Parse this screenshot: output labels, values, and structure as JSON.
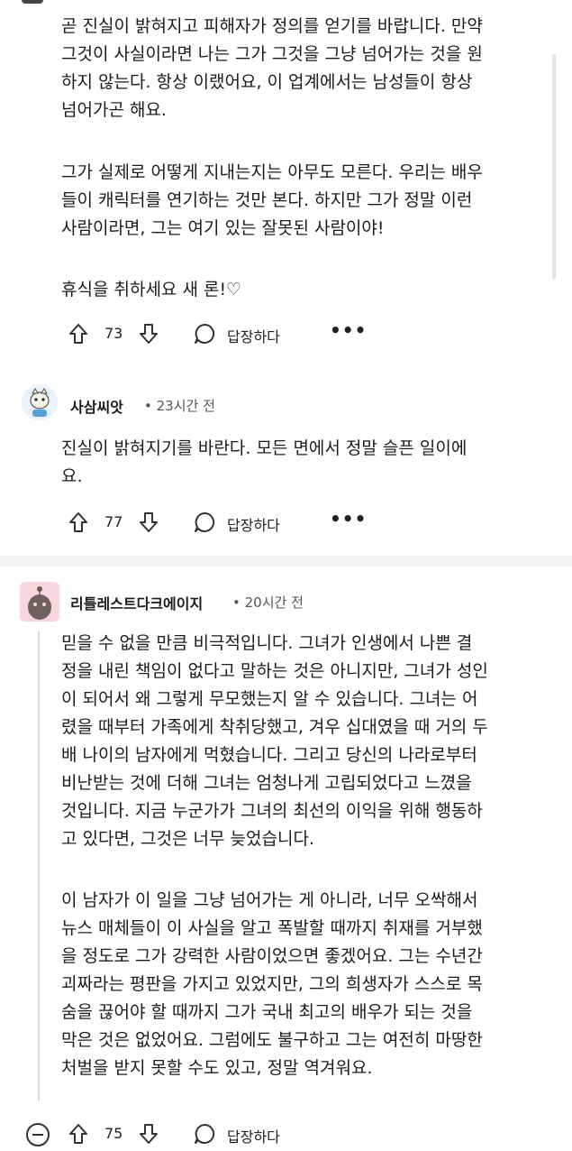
{
  "comment1": {
    "paragraphs": [
      "곧 진실이 밝혀지고 피해자가 정의를 얻기를 바랍니다. 만약\n그것이 사실이라면 나는 그가 그것을 그냥 넘어가는 것을 원\n하지 않는다. 항상 이랬어요, 이 업계에서는 남성들이 항상\n넘어가곤 해요.",
      "그가 실제로 어떻게 지내는지는 아무도 모른다. 우리는 배우\n들이 캐릭터를 연기하는 것만 본다. 하지만 그가 정말 이런\n사람이라면, 그는 여기 있는 잘못된 사람이야!",
      "휴식을 취하세요 새 론!♡"
    ],
    "votes": "73",
    "reply_label": "답장하다",
    "more": "•••"
  },
  "comment2": {
    "username": "사삼씨앗",
    "time": "• 23시간 전",
    "text": "진실이 밝혀지기를 바란다. 모든 면에서 정말 슬픈 일이에\n요.",
    "votes": "77",
    "reply_label": "답장하다",
    "more": "•••"
  },
  "comment3": {
    "username": "리틀레스트다크에이지",
    "time": "• 20시간 전",
    "paragraphs": [
      "믿을 수 없을 만큼 비극적입니다. 그녀가 인생에서 나쁜 결\n정을 내린 책임이 없다고 말하는 것은 아니지만, 그녀가 성인\n이 되어서 왜 그렇게 무모했는지 알 수 있습니다. 그녀는 어\n렸을 때부터 가족에게 착취당했고, 겨우 십대였을 때 거의 두\n배 나이의 남자에게 먹혔습니다. 그리고 당신의 나라로부터\n비난받는 것에 더해 그녀는 엄청나게 고립되었다고 느꼈을\n것입니다. 지금 누군가가 그녀의 최선의 이익을 위해 행동하\n고 있다면, 그것은 너무 늦었습니다.",
      "이 남자가 이 일을 그냥 넘어가는 게 아니라, 너무 오싹해서\n뉴스 매체들이 이 사실을 알고 폭발할 때까지 취재를 거부했\n을 정도로 그가 강력한 사람이었으면 좋겠어요. 그는 수년간\n괴짜라는 평판을 가지고 있었지만, 그의 희생자가 스스로 목\n숨을 끊어야 할 때까지 그가 국내 최고의 배우가 되는 것을\n막은 것은 없었어요. 그럼에도 불구하고 그는 여전히 마땅한\n처벌을 받지 못할 수도 있고, 정말 역겨워요."
    ],
    "votes": "75",
    "reply_label": "답장하다"
  },
  "colors": {
    "text": "#1c1c1c",
    "muted": "#555555",
    "thread": "#d9d9d9",
    "divider": "#f2f2f2"
  }
}
